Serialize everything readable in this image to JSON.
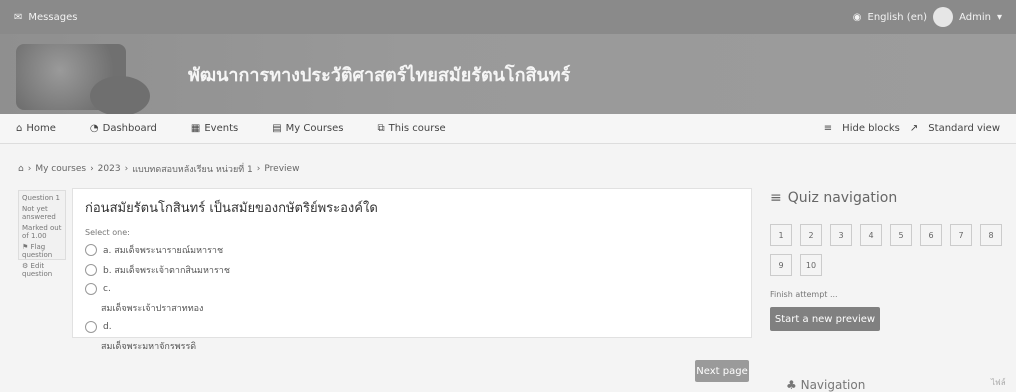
{
  "topbar": {
    "messages": "Messages",
    "language": "English (en)",
    "user": "Admin"
  },
  "banner": {
    "title": "พัฒนาการทางประวัติศาสตร์ไทยสมัยรัตนโกสินทร์"
  },
  "nav": {
    "home": "Home",
    "dashboard": "Dashboard",
    "events": "Events",
    "my_courses": "My Courses",
    "this_course": "This course",
    "hide_blocks": "Hide blocks",
    "standard_view": "Standard view"
  },
  "breadcrumb": {
    "items": [
      "My courses",
      "2023",
      "แบบทดสอบหลังเรียน หน่วยที่ 1",
      "Preview"
    ]
  },
  "question_info": {
    "label": "Question 1",
    "status": "Not yet answered",
    "marked": "Marked out of 1.00",
    "flag": "Flag question",
    "edit": "Edit question"
  },
  "question": {
    "text": "ก่อนสมัยรัตนโกสินทร์ เป็นสมัยของกษัตริย์พระองค์ใด",
    "select_one": "Select one:",
    "options": [
      {
        "label": "a. สมเด็จพระนารายณ์มหาราช",
        "note": ""
      },
      {
        "label": "b. สมเด็จพระเจ้าตากสินมหาราช",
        "note": ""
      },
      {
        "label": "c.",
        "note": "สมเด็จพระเจ้าปราสาททอง"
      },
      {
        "label": "d.",
        "note": "สมเด็จพระมหาจักรพรรดิ"
      }
    ]
  },
  "quiz_nav": {
    "title": "Quiz navigation",
    "cells": [
      "1",
      "2",
      "3",
      "4",
      "5",
      "6",
      "7",
      "8",
      "9",
      "10"
    ],
    "finish": "Finish attempt ...",
    "start_new": "Start a new preview"
  },
  "navigation": {
    "label": "Navigation",
    "corner": "ไฟล์"
  },
  "buttons": {
    "next_page": "Next page"
  }
}
